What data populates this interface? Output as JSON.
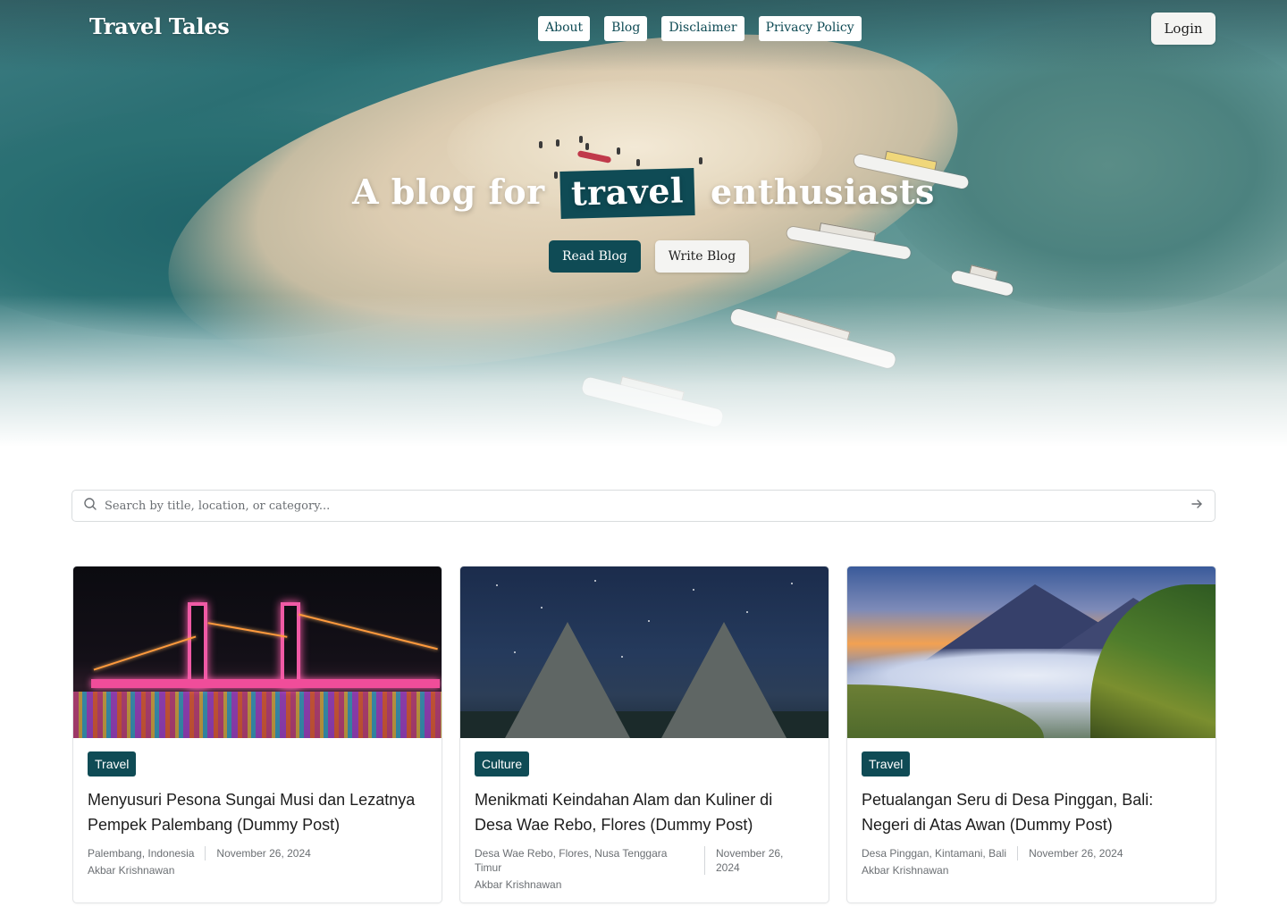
{
  "brand": {
    "name": "Travel Tales"
  },
  "nav": {
    "items": [
      {
        "label": "About"
      },
      {
        "label": "Blog"
      },
      {
        "label": "Disclaimer"
      },
      {
        "label": "Privacy Policy"
      }
    ]
  },
  "header": {
    "login_label": "Login"
  },
  "hero": {
    "headline_before": "A blog for",
    "headline_highlight": "travel",
    "headline_after": "enthusiasts",
    "read_label": "Read Blog",
    "write_label": "Write Blog"
  },
  "search": {
    "placeholder": "Search by title, location, or category..."
  },
  "colors": {
    "brand_dark_teal": "#0f4b55",
    "muted_text": "#6b6f73"
  },
  "posts": [
    {
      "category": "Travel",
      "title": "Menyusuri Pesona Sungai Musi dan Lezatnya Pempek Palembang (Dummy Post)",
      "location": "Palembang, Indonesia",
      "date": "November 26, 2024",
      "author": "Akbar Krishnawan"
    },
    {
      "category": "Culture",
      "title": "Menikmati Keindahan Alam dan Kuliner di Desa Wae Rebo, Flores (Dummy Post)",
      "location": "Desa Wae Rebo, Flores, Nusa Tenggara Timur",
      "date": "November 26, 2024",
      "author": "Akbar Krishnawan"
    },
    {
      "category": "Travel",
      "title": "Petualangan Seru di Desa Pinggan, Bali: Negeri di Atas Awan (Dummy Post)",
      "location": "Desa Pinggan, Kintamani, Bali",
      "date": "November 26, 2024",
      "author": "Akbar Krishnawan"
    }
  ]
}
